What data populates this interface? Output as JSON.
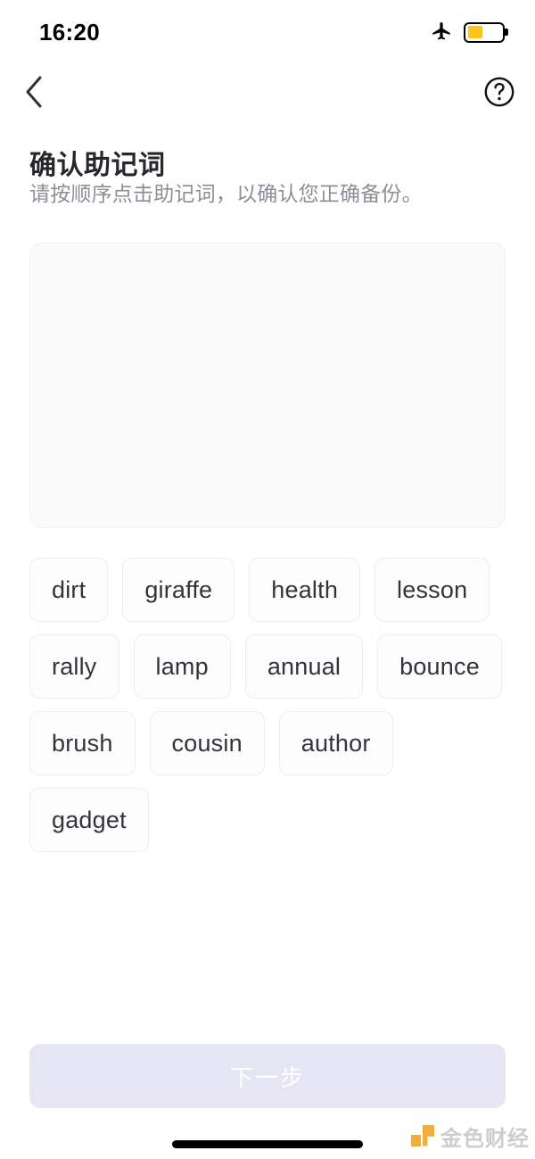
{
  "status_bar": {
    "time": "16:20",
    "airplane_icon": "airplane-mode-icon",
    "battery_icon": "battery-low-power-icon",
    "battery_level_percent": 45,
    "battery_fill_color": "#fcc419"
  },
  "nav_bar": {
    "back_icon": "chevron-left-icon",
    "help_icon": "question-mark-circle-icon"
  },
  "header": {
    "title": "确认助记词",
    "subtitle": "请按顺序点击助记词，以确认您正确备份。"
  },
  "answer_area": {
    "selected_words": [],
    "background_color": "#fafafa"
  },
  "word_bank": {
    "words": [
      "dirt",
      "giraffe",
      "health",
      "lesson",
      "rally",
      "lamp",
      "annual",
      "bounce",
      "brush",
      "cousin",
      "author",
      "gadget"
    ]
  },
  "footer": {
    "next_label": "下一步",
    "next_enabled": false,
    "next_background_color": "#e5e5f3",
    "next_text_color": "#ffffff"
  },
  "watermark": {
    "text": "金色财经",
    "logo_color": "#f0a92a"
  }
}
